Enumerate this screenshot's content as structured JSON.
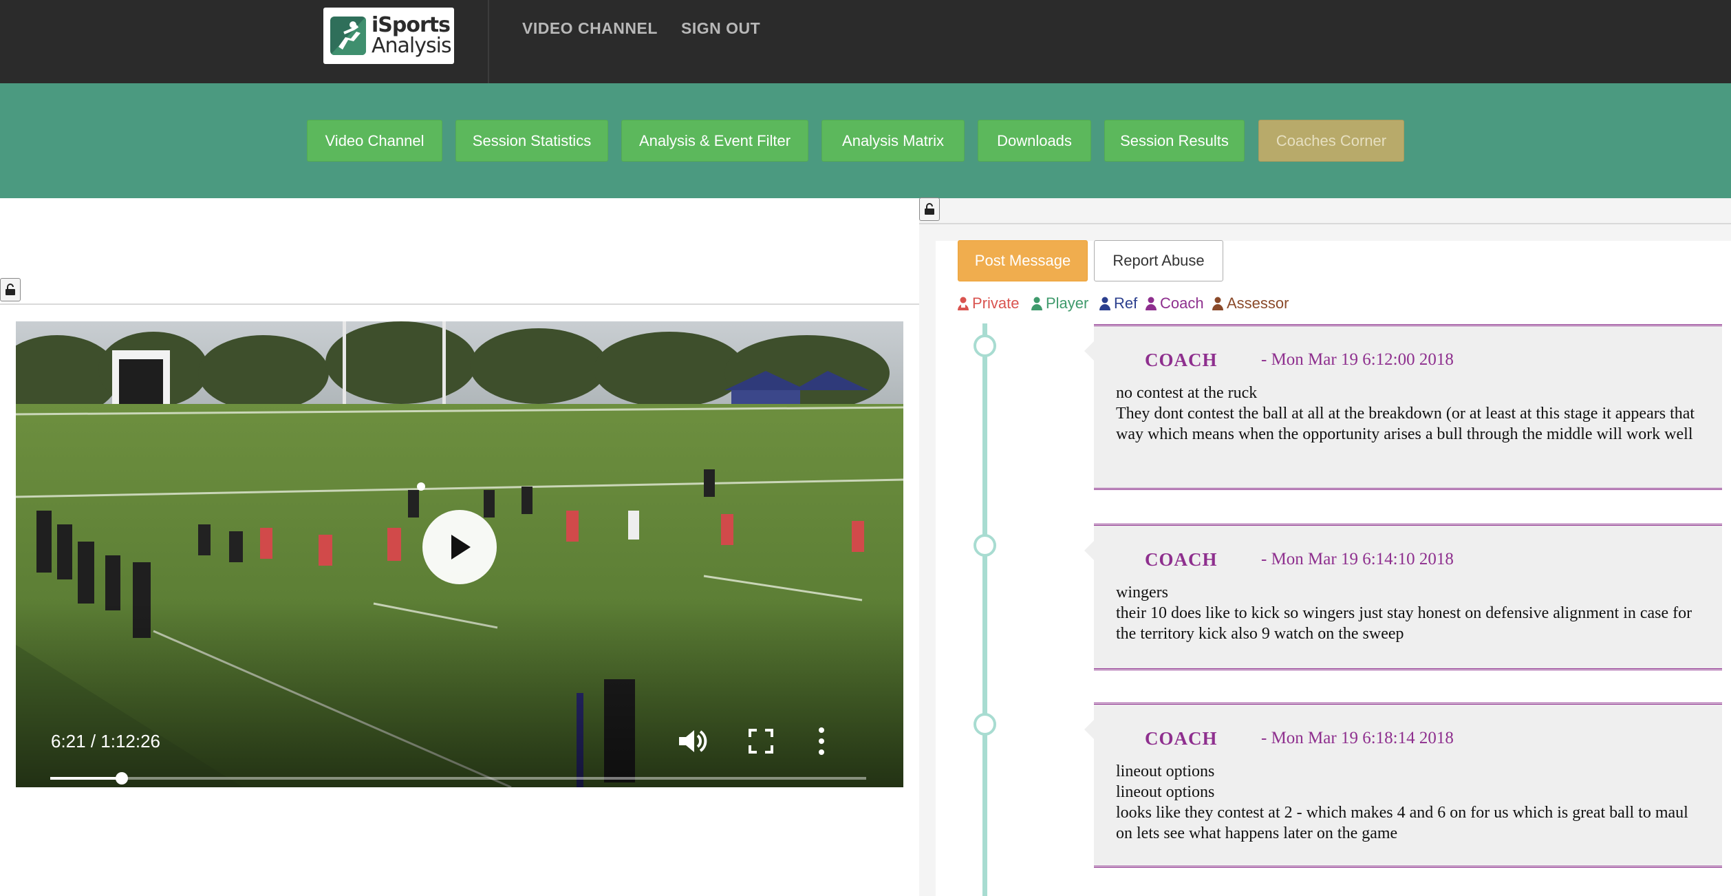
{
  "header": {
    "logo_line1": "iSports",
    "logo_line2": "Analysis",
    "nav": [
      "VIDEO CHANNEL",
      "SIGN OUT"
    ]
  },
  "main_nav": {
    "buttons": [
      "Video Channel",
      "Session Statistics",
      "Analysis & Event Filter",
      "Analysis Matrix",
      "Downloads",
      "Session Results",
      "Coaches Corner"
    ],
    "active": "Coaches Corner"
  },
  "video": {
    "time_display": "6:21 / 1:12:26",
    "progress_fraction": 0.0877
  },
  "comments_panel": {
    "post_button": "Post Message",
    "report_button": "Report Abuse",
    "legend": [
      {
        "label": "Private",
        "color": "#d9534f"
      },
      {
        "label": "Player",
        "color": "#3f9a6c"
      },
      {
        "label": "Ref",
        "color": "#2b3f8e"
      },
      {
        "label": "Coach",
        "color": "#8e2f8e"
      },
      {
        "label": "Assessor",
        "color": "#8a4a2a"
      }
    ],
    "messages": [
      {
        "role": "COACH",
        "date": "- Mon Mar 19 6:12:00 2018",
        "lines": [
          "no contest at the ruck",
          "They dont contest the ball at all at the breakdown (or at least at this stage it appears that way which means when the opportunity arises a bull through the middle will work well"
        ]
      },
      {
        "role": "COACH",
        "date": "- Mon Mar 19 6:14:10 2018",
        "lines": [
          "wingers",
          "their 10 does like to kick so wingers just stay honest on defensive alignment in case for the territory kick also 9 watch on the sweep"
        ]
      },
      {
        "role": "COACH",
        "date": "- Mon Mar 19 6:18:14 2018",
        "lines": [
          "lineout options",
          "lineout options",
          "looks like they contest at 2 - which makes 4 and 6 on for us which is great ball to maul on lets see what happens later on the game"
        ]
      }
    ]
  }
}
